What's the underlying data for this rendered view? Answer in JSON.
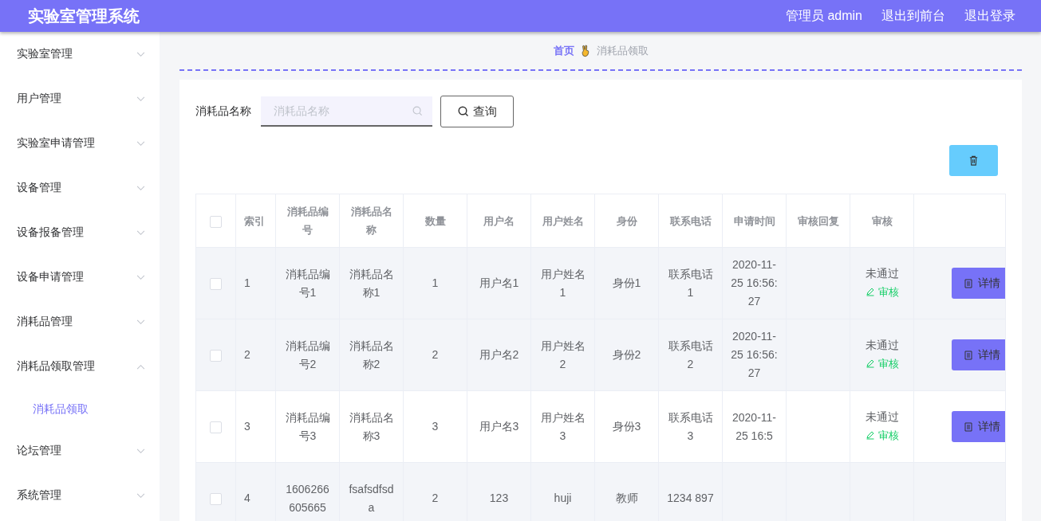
{
  "header": {
    "title": "实验室管理系统",
    "user": "管理员 admin",
    "links": [
      "退出到前台",
      "退出登录"
    ]
  },
  "sidebar": {
    "items": [
      {
        "label": "实验室管理",
        "expanded": false
      },
      {
        "label": "用户管理",
        "expanded": false
      },
      {
        "label": "实验室申请管理",
        "expanded": false
      },
      {
        "label": "设备管理",
        "expanded": false
      },
      {
        "label": "设备报备管理",
        "expanded": false
      },
      {
        "label": "设备申请管理",
        "expanded": false
      },
      {
        "label": "消耗品管理",
        "expanded": false
      },
      {
        "label": "消耗品领取管理",
        "expanded": true,
        "children": [
          {
            "label": "消耗品领取",
            "selected": true
          }
        ]
      },
      {
        "label": "论坛管理",
        "expanded": false
      },
      {
        "label": "系统管理",
        "expanded": false
      }
    ]
  },
  "breadcrumb": {
    "home": "首页",
    "current": "消耗品领取"
  },
  "search": {
    "label": "消耗品名称",
    "placeholder": "消耗品名称",
    "button": "查询"
  },
  "table": {
    "all_selected": false,
    "columns": [
      "索引",
      "消耗品编号",
      "消耗品名称",
      "数量",
      "用户名",
      "用户姓名",
      "身份",
      "联系电话",
      "申请时间",
      "审核回复",
      "审核"
    ],
    "rows": [
      {
        "selected": false,
        "highlighted": true,
        "cells": [
          "1",
          "消耗品编号1",
          "消耗品名称1",
          "1",
          "用户名1",
          "用户姓名1",
          "身份1",
          "联系电话1",
          "2020-11-25 16:56:27"
        ],
        "status": "未通过",
        "audit": "审核",
        "details": "详情"
      },
      {
        "selected": false,
        "highlighted": true,
        "cells": [
          "2",
          "消耗品编号2",
          "消耗品名称2",
          "2",
          "用户名2",
          "用户姓名2",
          "身份2",
          "联系电话2",
          "2020-11-25 16:56:27"
        ],
        "status": "未通过",
        "audit": "审核",
        "details": "详情"
      },
      {
        "selected": false,
        "highlighted": false,
        "cells": [
          "3",
          "消耗品编号3",
          "消耗品名称3",
          "3",
          "用户名3",
          "用户姓名3",
          "身份3",
          "联系电话3",
          "2020-11-25 16:5"
        ],
        "status": "未通过",
        "audit": "审核",
        "details": "详情"
      },
      {
        "selected": false,
        "highlighted": true,
        "cells": [
          "4",
          "1606266605665",
          "fsafsdfsda",
          "2",
          "123",
          "huji",
          "教师",
          "1234 897"
        ]
      }
    ]
  }
}
